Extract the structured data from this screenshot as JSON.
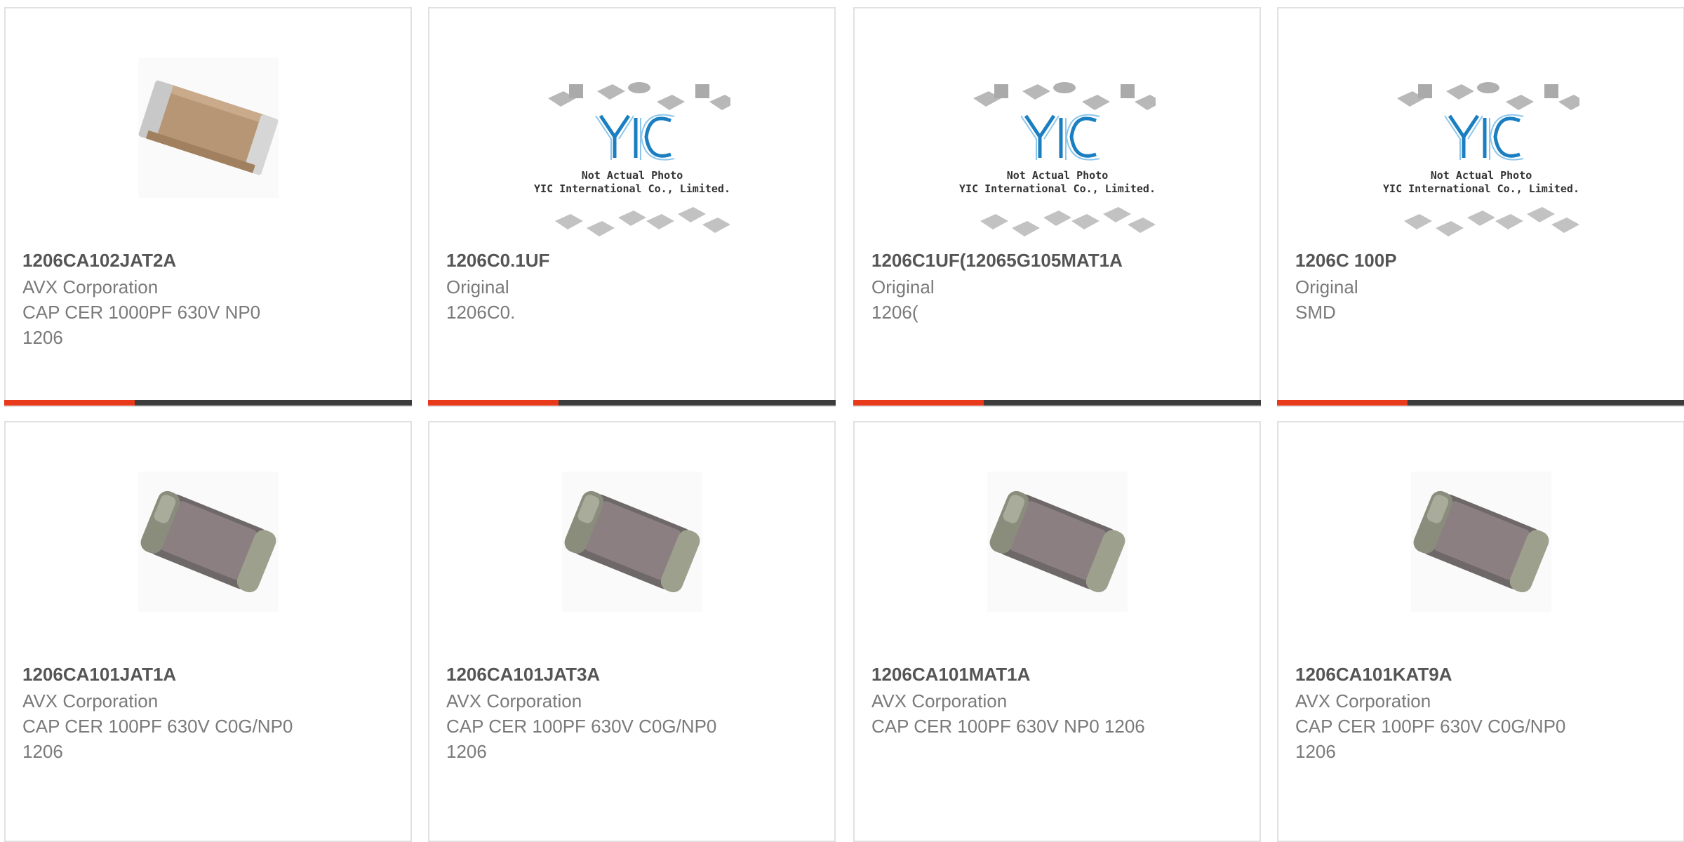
{
  "colors": {
    "accent": "#e8391a",
    "bar": "#3c3c3c"
  },
  "products": [
    {
      "part": "1206CA102JAT2A",
      "lines": [
        "AVX Corporation",
        "CAP CER 1000PF 630V NP0",
        "1206"
      ],
      "image": "capacitor-beige-icon"
    },
    {
      "part": "1206C0.1UF",
      "lines": [
        "Original",
        "1206C0."
      ],
      "image": "placeholder",
      "photo_label": "Not Actual Photo",
      "photo_company": "YIC International Co., Limited.",
      "logo": "YIC"
    },
    {
      "part": "1206C1UF(12065G105MAT1A",
      "lines": [
        "Original",
        "1206("
      ],
      "image": "placeholder",
      "photo_label": "Not Actual Photo",
      "photo_company": "YIC International Co., Limited.",
      "logo": "YIC"
    },
    {
      "part": "1206C 100P",
      "lines": [
        "Original",
        "SMD"
      ],
      "image": "placeholder",
      "photo_label": "Not Actual Photo",
      "photo_company": "YIC International Co., Limited.",
      "logo": "YIC"
    },
    {
      "part": "1206CA101JAT1A",
      "lines": [
        "AVX Corporation",
        "CAP CER 100PF 630V C0G/NP0",
        "1206"
      ],
      "image": "capacitor-grey-icon"
    },
    {
      "part": "1206CA101JAT3A",
      "lines": [
        "AVX Corporation",
        "CAP CER 100PF 630V C0G/NP0",
        "1206"
      ],
      "image": "capacitor-grey-icon"
    },
    {
      "part": "1206CA101MAT1A",
      "lines": [
        "AVX Corporation",
        "CAP CER 100PF 630V NP0 1206"
      ],
      "image": "capacitor-grey-icon"
    },
    {
      "part": "1206CA101KAT9A",
      "lines": [
        "AVX Corporation",
        "CAP CER 100PF 630V C0G/NP0",
        "1206"
      ],
      "image": "capacitor-grey-icon"
    }
  ]
}
